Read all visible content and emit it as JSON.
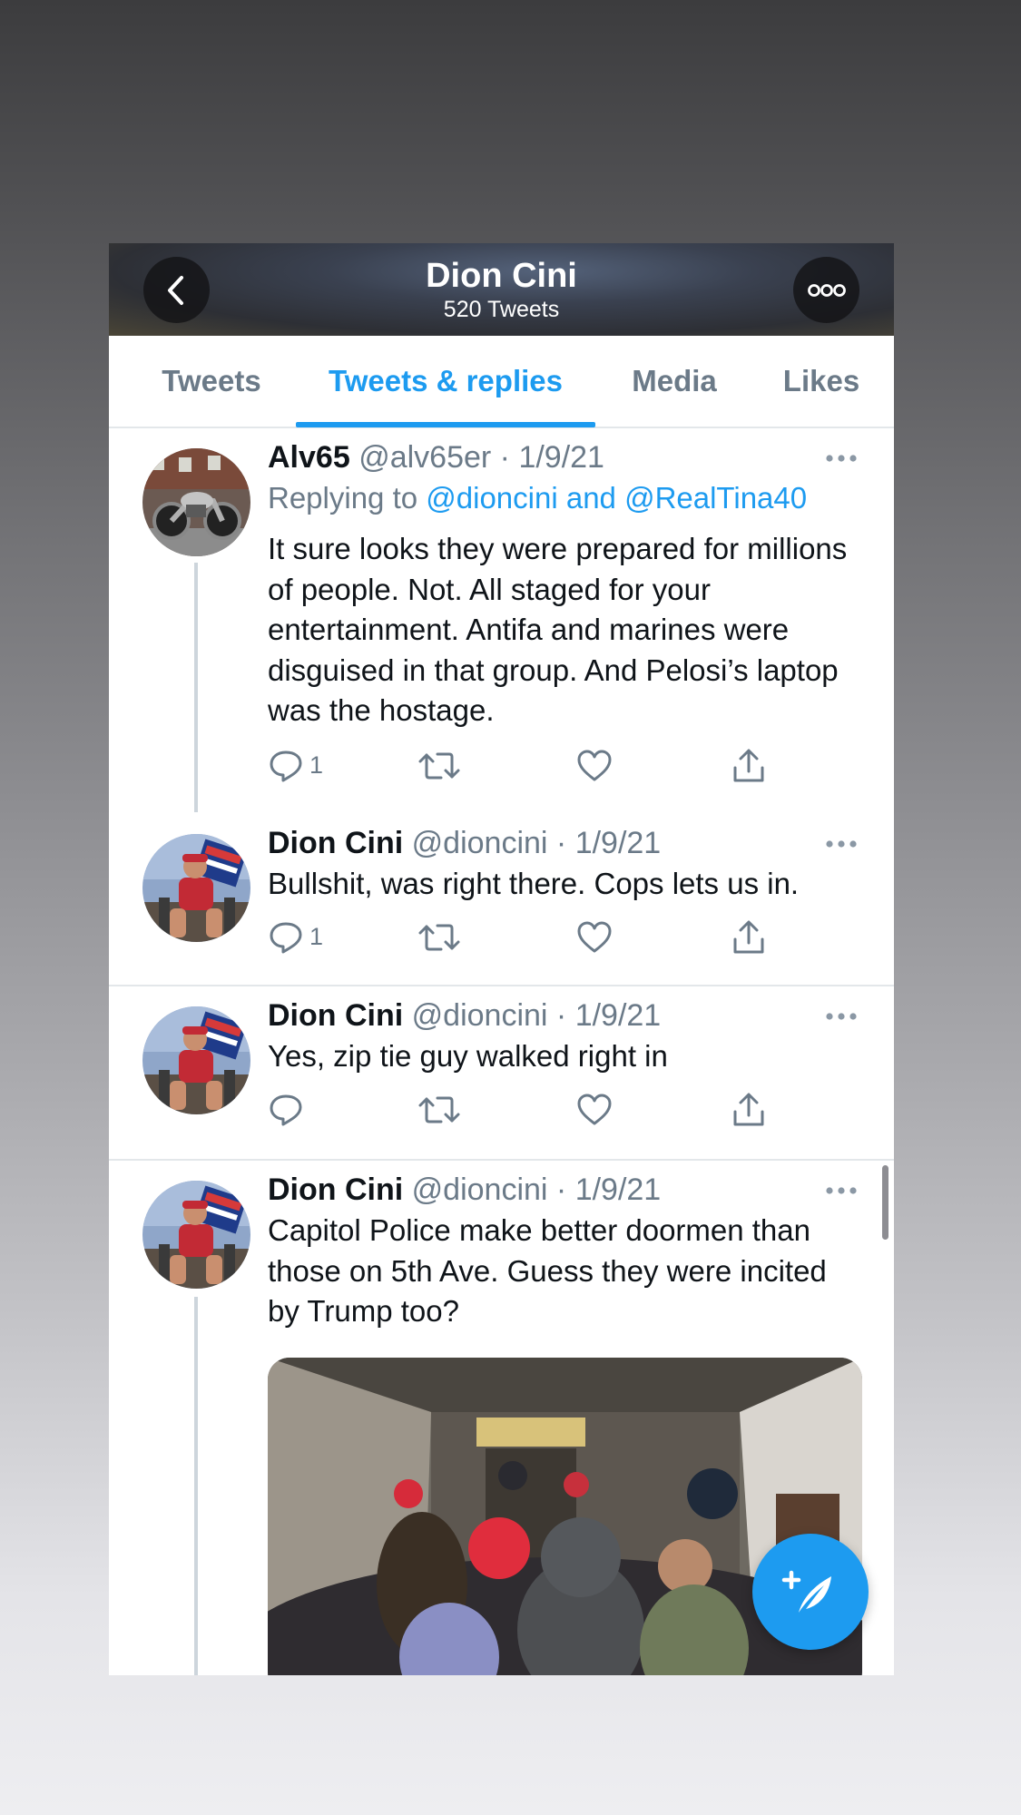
{
  "header": {
    "name": "Dion Cini",
    "tweet_count": "520 Tweets",
    "back_icon": "chevron-left-icon",
    "more_icon": "more-options-icon"
  },
  "tabs": [
    {
      "label": "Tweets",
      "active": false
    },
    {
      "label": "Tweets & replies",
      "active": true
    },
    {
      "label": "Media",
      "active": false
    },
    {
      "label": "Likes",
      "active": false
    }
  ],
  "tweets": [
    {
      "name": "Alv65",
      "handle": "@alv65er",
      "date": "1/9/21",
      "replying_prefix": "Replying to ",
      "replying_to": "@dioncini and @RealTina40",
      "text": "It sure looks they were prepared for millions of people. Not. All staged for your entertainment. Antifa and marines were disguised in that group. And Pelosi’s laptop was the hostage.",
      "reply_count": "1"
    },
    {
      "name": "Dion Cini",
      "handle": "@dioncini",
      "date": "1/9/21",
      "text": "Bullshit, was right there. Cops lets us in.",
      "reply_count": "1"
    },
    {
      "name": "Dion Cini",
      "handle": "@dioncini",
      "date": "1/9/21",
      "text": "Yes, zip tie guy walked right in",
      "reply_count": ""
    },
    {
      "name": "Dion Cini",
      "handle": "@dioncini",
      "date": "1/9/21",
      "text": "Capitol Police make better doormen than those on 5th Ave. Guess they were incited by Trump too?",
      "reply_count": ""
    }
  ],
  "separator": " · ",
  "compose_icon": "compose-tweet-icon",
  "colors": {
    "accent": "#1d9bf0",
    "secondary_text": "#6b7a88",
    "primary_text": "#0f1419"
  }
}
